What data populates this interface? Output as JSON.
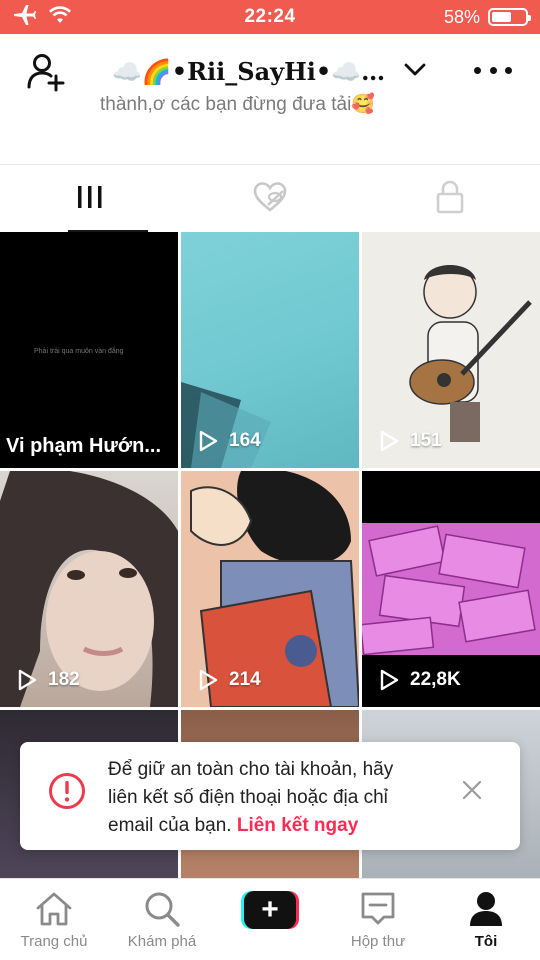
{
  "status_bar": {
    "time": "22:24",
    "battery_percent": "58%",
    "battery_level": 0.58,
    "icons": [
      "airplane-icon",
      "wifi-icon",
      "battery-icon"
    ]
  },
  "header": {
    "username": "☁️🌈•Rii_SayHi•☁️…",
    "add_user_icon": "add-user-icon",
    "dropdown_icon": "chevron-down-icon",
    "more_icon": "more-dots-icon"
  },
  "bio_peek": "thành,ơ các bạn đừng đưa tải🥰",
  "tabs": [
    {
      "name": "videos",
      "icon": "grid-icon",
      "active": true
    },
    {
      "name": "liked",
      "icon": "hidden-heart-icon",
      "active": false
    },
    {
      "name": "private",
      "icon": "lock-icon",
      "active": false
    }
  ],
  "videos": [
    {
      "label": "Vi phạm Hướn...",
      "views": "",
      "caption": "Phải trải qua muôn vàn đắng"
    },
    {
      "views": "164"
    },
    {
      "views": "151"
    },
    {
      "views": "182"
    },
    {
      "views": "214"
    },
    {
      "views": "22,8K"
    }
  ],
  "toast": {
    "message": "Để giữ an toàn cho tài khoản, hãy liên kết số điện thoại hoặc địa chỉ email của bạn.",
    "link": "Liên kết ngay",
    "icon": "warning-icon",
    "close_icon": "close-icon"
  },
  "bottom_nav": [
    {
      "label": "Trang chủ",
      "icon": "home-icon"
    },
    {
      "label": "Khám phá",
      "icon": "search-icon"
    },
    {
      "label": "",
      "icon": "create-plus-icon"
    },
    {
      "label": "Hộp thư",
      "icon": "inbox-icon"
    },
    {
      "label": "Tôi",
      "icon": "profile-icon",
      "active": true
    }
  ],
  "colors": {
    "status_bar": "#f05a4f",
    "accent": "#fe2c55",
    "cyan": "#25f4ee",
    "text": "#111111"
  }
}
